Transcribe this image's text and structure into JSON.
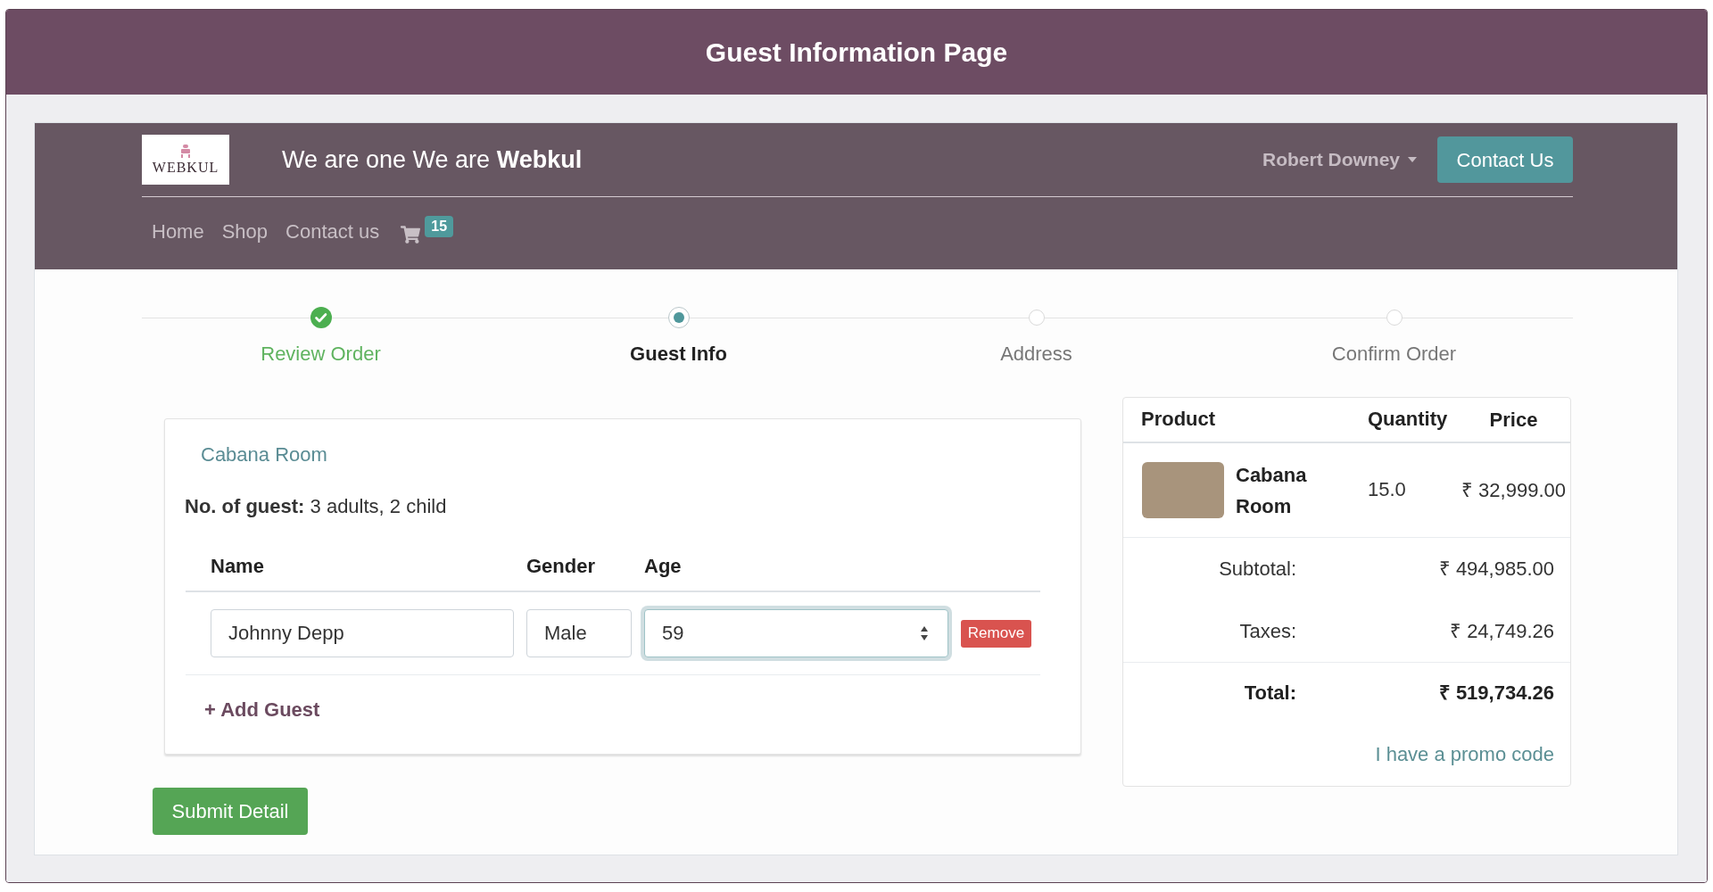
{
  "page_title": "Guest Information Page",
  "site_header": {
    "logo_text": "WEBKUL",
    "tagline": "We are one We are **Webkul**",
    "user_menu": "Robert Downey",
    "contact_button": "Contact Us",
    "nav": [
      {
        "label": "Home"
      },
      {
        "label": "Shop"
      },
      {
        "label": "Contact us"
      }
    ],
    "cart_count": "15"
  },
  "steps": [
    {
      "label": "Review Order",
      "done": true,
      "selected": false
    },
    {
      "label": "Guest Info",
      "done": false,
      "selected": true
    },
    {
      "label": "Address",
      "done": false,
      "selected": false
    },
    {
      "label": "Confirm Order",
      "done": false,
      "selected": false
    }
  ],
  "guest_form": {
    "room": "Cabana Room",
    "guest_count": "**No. of guest:** 3 adults, 2 child",
    "columns": [
      "Name",
      "Gender",
      "Age"
    ],
    "guests": [
      {
        "name": "Johnny Depp",
        "gender": "Male",
        "age": "59",
        "age_focused": true
      }
    ],
    "remove_button": "Remove",
    "add_guest": "+ Add Guest"
  },
  "submit_button": "Submit Detail",
  "order_summary": {
    "columns": [
      "Product",
      "Quantity",
      "Price"
    ],
    "items": [
      {
        "name": "Cabana Room",
        "quantity": "15.0",
        "price": "₹ 32,999.00"
      }
    ],
    "totals": [
      {
        "kind": "normal",
        "label": "Subtotal:",
        "value": "₹ 494,985.00"
      },
      {
        "kind": "normal",
        "label": "Taxes:",
        "value": "₹ 24,749.26"
      },
      {
        "kind": "grand",
        "label": "Total:",
        "value": "₹ 519,734.26"
      }
    ],
    "promo_link": "I have a promo code"
  }
}
